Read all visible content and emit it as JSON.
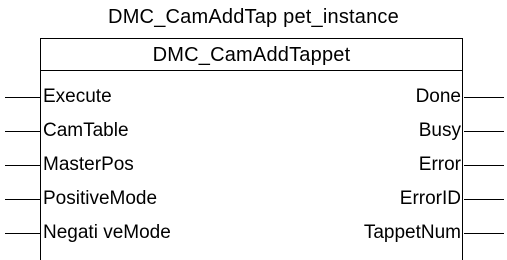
{
  "instance_name": "DMC_CamAddTap pet_instance",
  "block_name": "DMC_CamAddTappet",
  "inputs": [
    "Execute",
    "CamTable",
    "MasterPos",
    "PositiveMode",
    "Negati veMode"
  ],
  "outputs": [
    "Done",
    "Busy",
    "Error",
    "ErrorID",
    "TappetNum"
  ]
}
